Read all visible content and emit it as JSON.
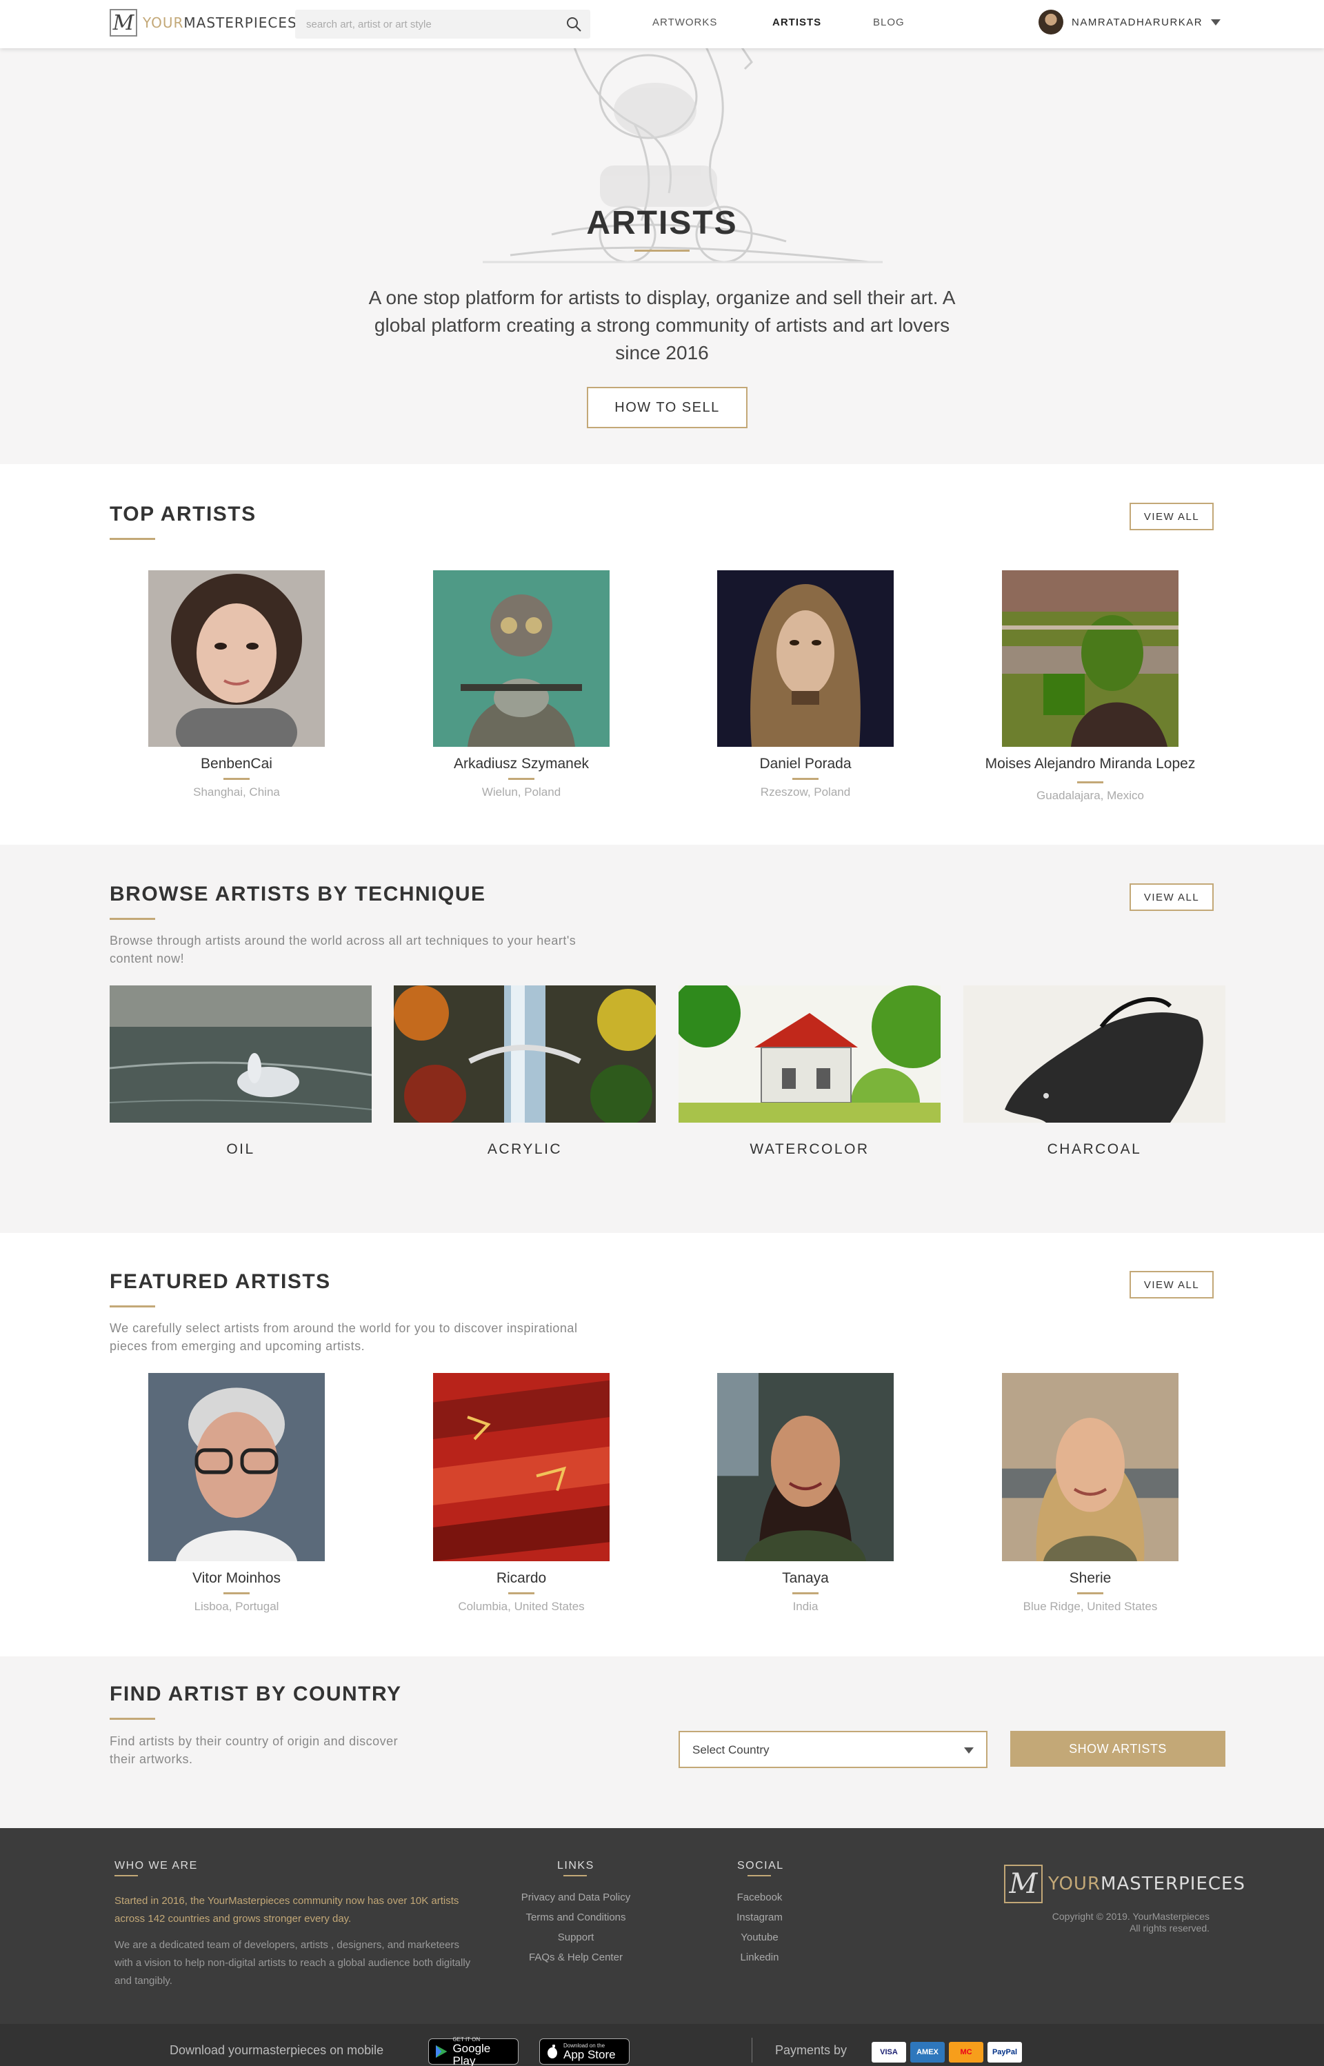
{
  "header": {
    "logo_your": "YOUR",
    "logo_master": "MASTERPIECES",
    "search_placeholder": "search art, artist or art style",
    "nav": [
      {
        "label": "ARTWORKS",
        "active": false
      },
      {
        "label": "ARTISTS",
        "active": true
      },
      {
        "label": "BLOG",
        "active": false
      }
    ],
    "user_name": "NAMRATADHARURKAR"
  },
  "hero": {
    "title": "ARTISTS",
    "description": "A one stop platform for artists to display, organize and sell their art. A global platform creating a strong community of artists and art lovers since 2016",
    "button": "HOW TO SELL"
  },
  "top_artists": {
    "title": "TOP ARTISTS",
    "view_all": "VIEW ALL",
    "artists": [
      {
        "name": "BenbenCai",
        "location": "Shanghai, China"
      },
      {
        "name": "Arkadiusz Szymanek",
        "location": "Wielun, Poland"
      },
      {
        "name": "Daniel Porada",
        "location": "Rzeszow, Poland"
      },
      {
        "name": "Moises Alejandro Miranda Lopez",
        "location": "Guadalajara, Mexico"
      }
    ]
  },
  "techniques": {
    "title": "BROWSE ARTISTS BY TECHNIQUE",
    "view_all": "VIEW ALL",
    "subtitle": "Browse through artists around the world across all art techniques to your heart's content now!",
    "items": [
      {
        "label": "OIL"
      },
      {
        "label": "ACRYLIC"
      },
      {
        "label": "WATERCOLOR"
      },
      {
        "label": "CHARCOAL"
      }
    ]
  },
  "featured": {
    "title": "FEATURED ARTISTS",
    "view_all": "VIEW ALL",
    "subtitle": "We carefully select artists from around the world for you to discover inspirational pieces from emerging and upcoming artists.",
    "artists": [
      {
        "name": "Vitor Moinhos",
        "location": "Lisboa, Portugal"
      },
      {
        "name": "Ricardo",
        "location": "Columbia, United States"
      },
      {
        "name": "Tanaya",
        "location": "India"
      },
      {
        "name": "Sherie",
        "location": "Blue Ridge, United States"
      }
    ]
  },
  "country": {
    "title": "FIND ARTIST BY COUNTRY",
    "subtitle": "Find artists by their country of origin and discover their artworks.",
    "select_value": "Select Country",
    "button": "SHOW ARTISTS"
  },
  "footer": {
    "who_title": "WHO WE ARE",
    "who_gold": "Started in 2016, the YourMasterpieces community now has over 10K artists across 142 countries and grows stronger every day.",
    "who_text": "We are a dedicated team of developers, artists , designers, and marketeers with a vision to help non-digital artists to reach a global audience both digitally and tangibly.",
    "links_title": "LINKS",
    "links": [
      "Privacy and Data Policy",
      "Terms and Conditions",
      "Support",
      "FAQs & Help Center"
    ],
    "social_title": "SOCIAL",
    "social": [
      "Facebook",
      "Instagram",
      "Youtube",
      "Linkedin"
    ],
    "copyright_1": "Copyright © 2019. YourMasterpieces",
    "copyright_2": "All rights reserved.",
    "download_text": "Download yourmasterpieces on mobile",
    "google_small": "GET IT ON",
    "google_big": "Google Play",
    "apple_small": "Download on the",
    "apple_big": "App Store",
    "payments_label": "Payments by",
    "payments": [
      "VISA",
      "AMEX",
      "MC",
      "PayPal"
    ]
  }
}
